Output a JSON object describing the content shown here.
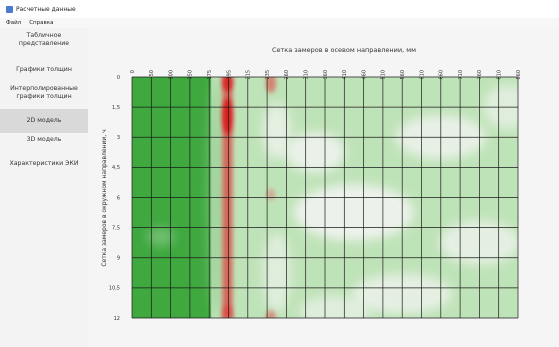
{
  "window": {
    "title": "Расчетные данные"
  },
  "menu": {
    "file": "Файл",
    "help": "Справка"
  },
  "sidebar": {
    "items": [
      {
        "label_line1": "Табличное",
        "label_line2": "представление"
      },
      {
        "label": "Графики толщин"
      },
      {
        "label_line1": "Интерполированные",
        "label_line2": "графики толщин"
      },
      {
        "label": "2D модель"
      },
      {
        "label": "3D модель"
      },
      {
        "label": "Характеристики ЭКИ"
      }
    ]
  },
  "chart_data": {
    "type": "heatmap",
    "title": "Сетка замеров в осевом направлении, мм",
    "xlabel": "Сетка замеров в осевом направлении, мм",
    "ylabel": "Сетка замеров в окружном направлении, ч",
    "x_ticks": [
      "0",
      "50",
      "100",
      "150",
      "175",
      "195",
      "215",
      "235",
      "260",
      "310",
      "360",
      "410",
      "460",
      "510",
      "560",
      "610",
      "660",
      "710",
      "760",
      "810",
      "860"
    ],
    "y_ticks": [
      "0",
      "1,5",
      "3",
      "4,5",
      "6",
      "7,5",
      "9",
      "10,5",
      "12"
    ],
    "colors": {
      "low": "#3fa83f",
      "mid": "#f5f5f5",
      "high": "#e03030"
    },
    "grid": true
  }
}
